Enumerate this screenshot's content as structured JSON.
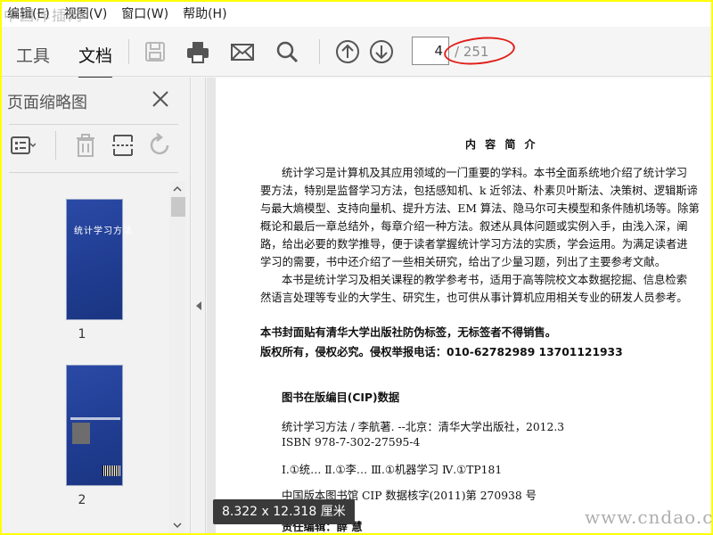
{
  "menubar": {
    "items": [
      "编辑(E)",
      "视图(V)",
      "窗口(W)",
      "帮助(H)"
    ],
    "watermark": "中国洋插网"
  },
  "toolbar": {
    "tab_tools": "工具",
    "tab_document": "文档",
    "icons": [
      "save-icon",
      "print-icon",
      "mail-icon",
      "search-icon",
      "page-up-icon",
      "page-down-icon"
    ],
    "page_current": "4",
    "page_total": "/ 251",
    "highlight_color": "#e0201b"
  },
  "panel": {
    "title": "页面缩略图",
    "icons": [
      "options-icon",
      "delete-icon",
      "insert-page-icon",
      "rotate-icon",
      "close-icon"
    ],
    "thumbnails": [
      {
        "label": "1",
        "cover_title": "统计学习方法"
      },
      {
        "label": "2"
      }
    ]
  },
  "document": {
    "heading": "内 容 简 介",
    "lines": [
      "统计学习是计算机及其应用领域的一门重要的学科。本书全面系统地介绍了统计学习",
      "要方法，特别是监督学习方法，包括感知机、k 近邻法、朴素贝叶斯法、决策树、逻辑斯谛",
      "与最大熵模型、支持向量机、提升方法、EM 算法、隐马尔可夫模型和条件随机场等。除第",
      "概论和最后一章总结外，每章介绍一种方法。叙述从具体问题或实例入手，由浅入深，阐",
      "路，给出必要的数学推导，便于读者掌握统计学习方法的实质，学会运用。为满足读者进",
      "学习的需要，书中还介绍了一些相关研究，给出了少量习题，列出了主要参考文献。",
      "本书是统计学习及相关课程的教学参考书，适用于高等院校文本数据挖掘、信息检索",
      "然语言处理等专业的大学生、研究生，也可供从事计算机应用相关专业的研发人员参考。"
    ],
    "notice_1": "本书封面贴有清华大学出版社防伪标签，无标签者不得销售。",
    "notice_2": "版权所有，侵权必究。侵权举报电话：010-62782989   13701121933",
    "cip_title": "图书在版编目(CIP)数据",
    "cip_1": "统计学习方法 / 李航著. --北京：清华大学出版社，2012.3",
    "cip_2": "ISBN 978-7-302-27595-4",
    "cip_3": "Ⅰ.①统…   Ⅱ.①李…   Ⅲ.①机器学习   Ⅳ.①TP181",
    "cip_4": "中国版本图书馆 CIP 数据核字(2011)第 270938 号",
    "cip_5": "责任编辑：薛  慧"
  },
  "tooltip": {
    "size": "8.322 x 12.318 厘米"
  },
  "watermark_br": "www.cndao.com"
}
